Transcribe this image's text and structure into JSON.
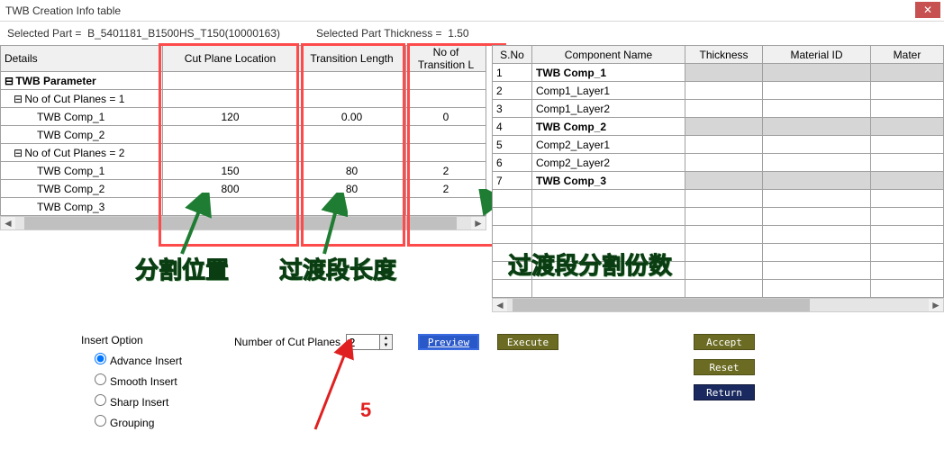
{
  "window": {
    "title": "TWB Creation Info table"
  },
  "info": {
    "selected_part_label": "Selected Part =",
    "selected_part_value": "B_5401181_B1500HS_T150(10000163)",
    "thickness_label": "Selected Part Thickness =",
    "thickness_value": "1.50"
  },
  "left_table": {
    "headers": [
      "Details",
      "Cut Plane Location",
      "Transition Length",
      "No of Transition L"
    ],
    "rows": [
      {
        "label": "TWB Parameter",
        "indent": 0,
        "glyph": "⊟",
        "cpl": "",
        "tl": "",
        "nt": ""
      },
      {
        "label": "No of Cut Planes = 1",
        "indent": 1,
        "glyph": "⊟",
        "cpl": "",
        "tl": "",
        "nt": ""
      },
      {
        "label": "TWB Comp_1",
        "indent": 2,
        "glyph": "",
        "cpl": "120",
        "tl": "0.00",
        "nt": "0"
      },
      {
        "label": "TWB Comp_2",
        "indent": 2,
        "glyph": "",
        "cpl": "",
        "tl": "",
        "nt": ""
      },
      {
        "label": "No of Cut Planes = 2",
        "indent": 1,
        "glyph": "⊟",
        "cpl": "",
        "tl": "",
        "nt": ""
      },
      {
        "label": "TWB Comp_1",
        "indent": 2,
        "glyph": "",
        "cpl": "150",
        "tl": "80",
        "nt": "2"
      },
      {
        "label": "TWB Comp_2",
        "indent": 2,
        "glyph": "",
        "cpl": "800",
        "tl": "80",
        "nt": "2"
      },
      {
        "label": "TWB Comp_3",
        "indent": 2,
        "glyph": "",
        "cpl": "",
        "tl": "",
        "nt": ""
      }
    ]
  },
  "right_table": {
    "headers": [
      "S.No",
      "Component Name",
      "Thickness",
      "Material ID",
      "Mater"
    ],
    "rows": [
      {
        "sno": "1",
        "name": "TWB Comp_1",
        "bold": true,
        "shaded": true
      },
      {
        "sno": "2",
        "name": "Comp1_Layer1",
        "bold": false,
        "shaded": false
      },
      {
        "sno": "3",
        "name": "Comp1_Layer2",
        "bold": false,
        "shaded": false
      },
      {
        "sno": "4",
        "name": "TWB Comp_2",
        "bold": true,
        "shaded": true
      },
      {
        "sno": "5",
        "name": "Comp2_Layer1",
        "bold": false,
        "shaded": false
      },
      {
        "sno": "6",
        "name": "Comp2_Layer2",
        "bold": false,
        "shaded": false
      },
      {
        "sno": "7",
        "name": "TWB Comp_3",
        "bold": true,
        "shaded": true
      }
    ]
  },
  "annotations": {
    "a1": "分割位置",
    "a2": "过渡段长度",
    "a3": "过渡段分割份数",
    "a5": "5"
  },
  "bottom": {
    "insert_option_title": "Insert Option",
    "radios": {
      "advance": "Advance Insert",
      "smooth": "Smooth Insert",
      "sharp": "Sharp Insert",
      "grouping": "Grouping"
    },
    "nc_label": "Number of Cut Planes",
    "nc_value": "2",
    "preview": "Preview",
    "execute": "Execute",
    "accept": "Accept",
    "reset": "Reset",
    "return": "Return"
  }
}
